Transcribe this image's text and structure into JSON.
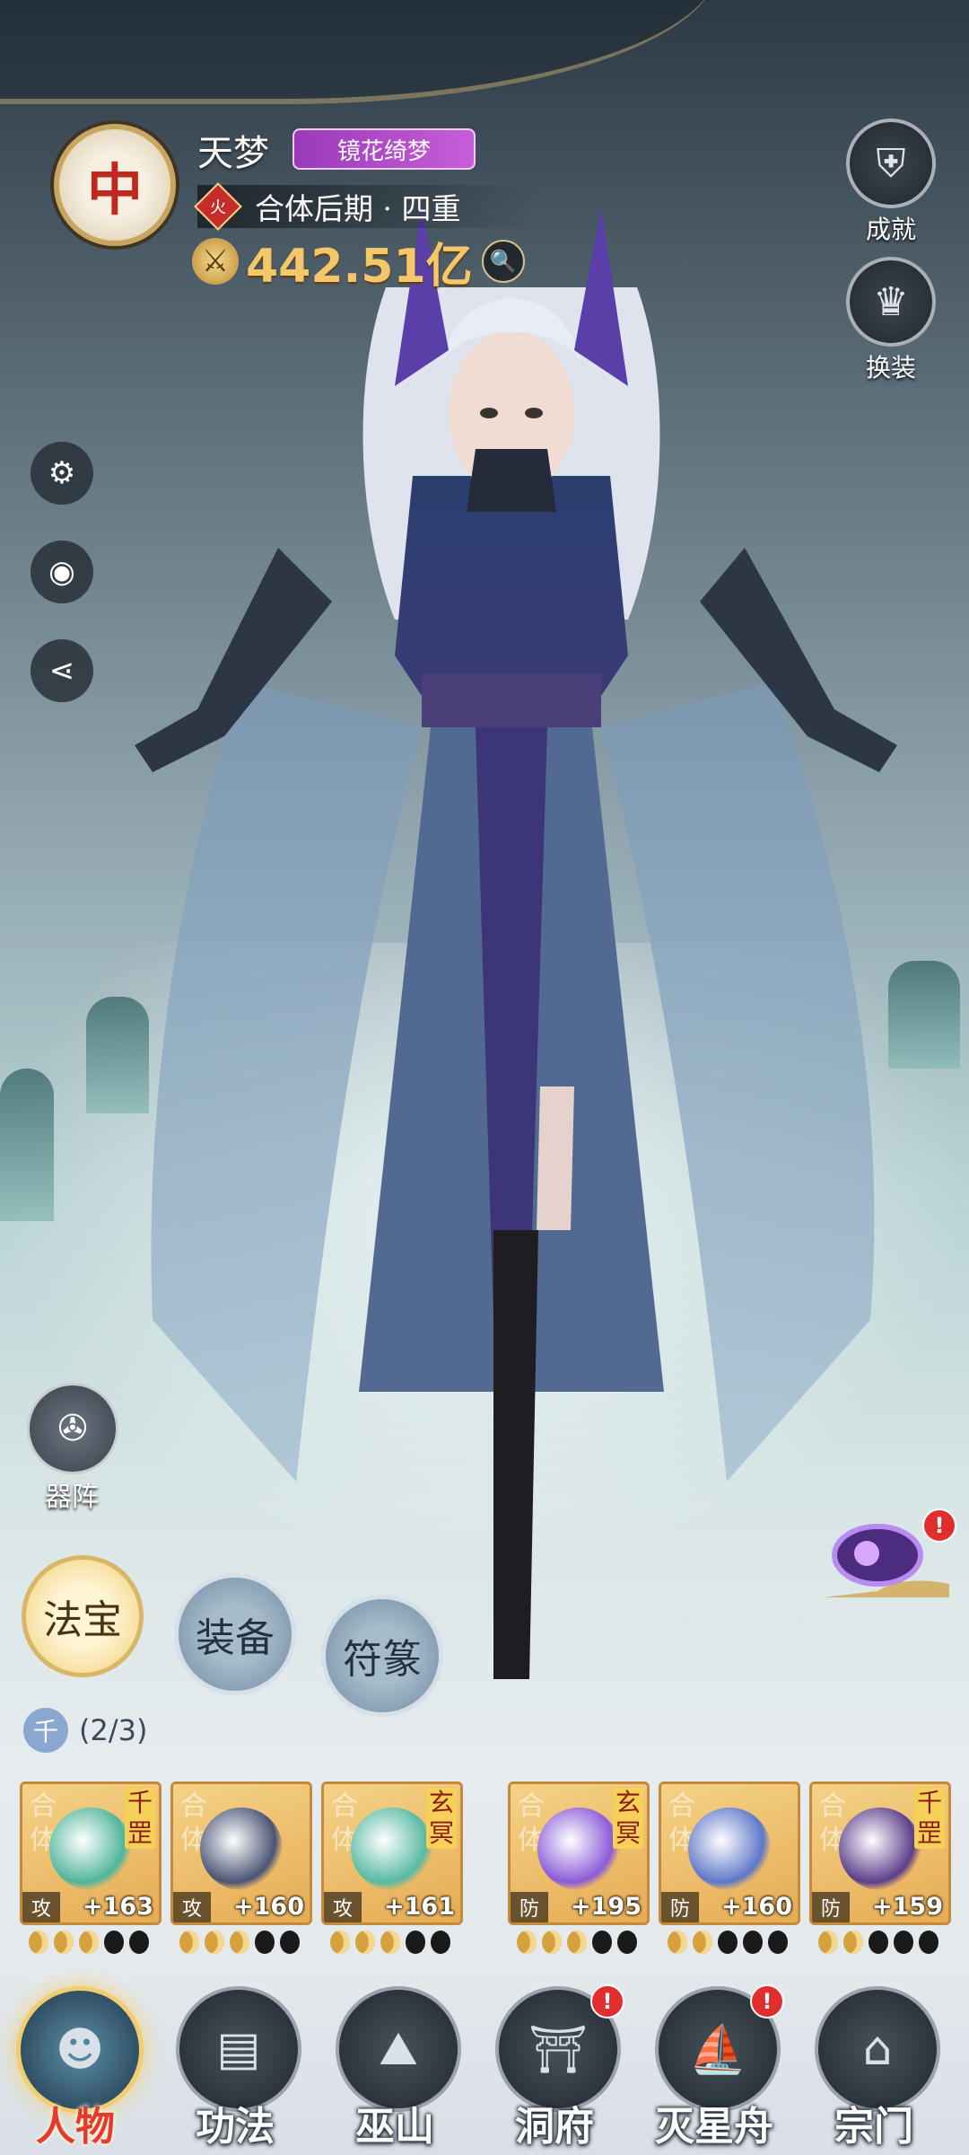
{
  "player": {
    "name": "天梦",
    "title_badge": "镜花绮梦",
    "avatar_glyph": "中",
    "element": "火",
    "realm": "合体后期 · 四重",
    "power": "442.51亿"
  },
  "side_buttons": {
    "achievements": "成就",
    "outfit": "换装",
    "formation": "器阵"
  },
  "tabs": {
    "treasure": "法宝",
    "equipment": "装备",
    "talisman": "符篆"
  },
  "set_bonus": {
    "badge": "千",
    "count": "(2/3)"
  },
  "slots": [
    {
      "ghost": "合体",
      "grade": "千罡",
      "type": "攻",
      "level": "+163",
      "stars_on": 3,
      "stars_off": 2,
      "art_color": "#4fb59b"
    },
    {
      "ghost": "合体",
      "grade": "",
      "type": "攻",
      "level": "+160",
      "stars_on": 3,
      "stars_off": 2,
      "art_color": "#4a5574"
    },
    {
      "ghost": "合体",
      "grade": "玄冥",
      "type": "攻",
      "level": "+161",
      "stars_on": 3,
      "stars_off": 2,
      "art_color": "#58b9a3"
    },
    {
      "ghost": "合体",
      "grade": "玄冥",
      "type": "防",
      "level": "+195",
      "stars_on": 3,
      "stars_off": 2,
      "art_color": "#8b5bd8"
    },
    {
      "ghost": "合体",
      "grade": "",
      "type": "防",
      "level": "+160",
      "stars_on": 2,
      "stars_off": 3,
      "art_color": "#5f77c9"
    },
    {
      "ghost": "合体",
      "grade": "千罡",
      "type": "防",
      "level": "+159",
      "stars_on": 2,
      "stars_off": 3,
      "art_color": "#5c3e8a"
    }
  ],
  "nav": [
    {
      "label": "人物",
      "icon": "character-icon",
      "glyph": "☻",
      "active": true,
      "alert": false
    },
    {
      "label": "功法",
      "icon": "scroll-cards-icon",
      "glyph": "▤",
      "active": false,
      "alert": false
    },
    {
      "label": "巫山",
      "icon": "mountain-icon",
      "glyph": "⛰",
      "active": false,
      "alert": false
    },
    {
      "label": "洞府",
      "icon": "cave-dwelling-icon",
      "glyph": "⛩",
      "active": false,
      "alert": true
    },
    {
      "label": "灭星舟",
      "icon": "star-ship-icon",
      "glyph": "⛵",
      "active": false,
      "alert": true
    },
    {
      "label": "宗门",
      "icon": "sect-gate-icon",
      "glyph": "⌂",
      "active": false,
      "alert": false
    }
  ],
  "colors": {
    "accent_gold": "#f0cd6f",
    "alert_red": "#e02d2d",
    "title_purple": "#c65ed8"
  }
}
